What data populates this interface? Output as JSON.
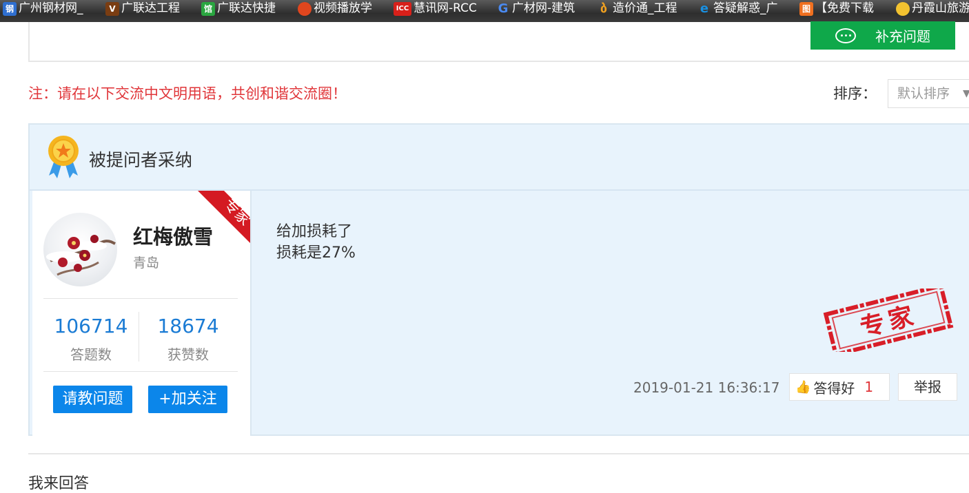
{
  "bookmarks": [
    {
      "label": "广州钢材网_",
      "icon": "gz-steel-icon",
      "color": "#2f6fd0"
    },
    {
      "label": "广联达工程",
      "icon": "glodon-icon",
      "color": "#7a3d12"
    },
    {
      "label": "广联达快捷",
      "icon": "glodon-quick-icon",
      "color": "#2aa640"
    },
    {
      "label": "视频播放学",
      "icon": "video-icon",
      "color": "#e0461e"
    },
    {
      "label": "慧讯网-RCC",
      "icon": "rcc-icon",
      "color": "#d8201a"
    },
    {
      "label": "广材网-建筑",
      "icon": "gcw-icon",
      "color": "#2266cc"
    },
    {
      "label": "造价通_工程",
      "icon": "zjt-icon",
      "color": "#f0a020"
    },
    {
      "label": "答疑解惑_广",
      "icon": "ie-icon",
      "color": "#1a8fe0"
    },
    {
      "label": "【免费下载",
      "icon": "download-icon",
      "color": "#f07020"
    },
    {
      "label": "丹霞山旅游",
      "icon": "danxia-icon",
      "color": "#f2c230"
    }
  ],
  "top": {
    "add_question_label": "补充问题"
  },
  "notice": "注：请在以下交流中文明用语，共创和谐交流圈！",
  "sort": {
    "label": "排序：",
    "selected": "默认排序"
  },
  "accepted": {
    "title": "被提问者采纳",
    "user": {
      "name": "红梅傲雪",
      "city": "青岛",
      "badge": "专家",
      "answers_count": "106714",
      "answers_label": "答题数",
      "likes_count": "18674",
      "likes_label": "获赞数",
      "ask_label": "请教问题",
      "follow_label": "加关注"
    },
    "answer_lines": [
      "给加损耗了",
      "损耗是27%"
    ],
    "stamp_text": "专家",
    "datetime": "2019-01-21 16:36:17",
    "good_label": "答得好",
    "good_count": "1",
    "report_label": "举报"
  },
  "my_answer_label": "我来回答",
  "colors": {
    "accent_green": "#0fa84a",
    "accent_blue": "#0b86ea",
    "notice_red": "#e0363a",
    "panel_bg": "#e8f3fc"
  }
}
